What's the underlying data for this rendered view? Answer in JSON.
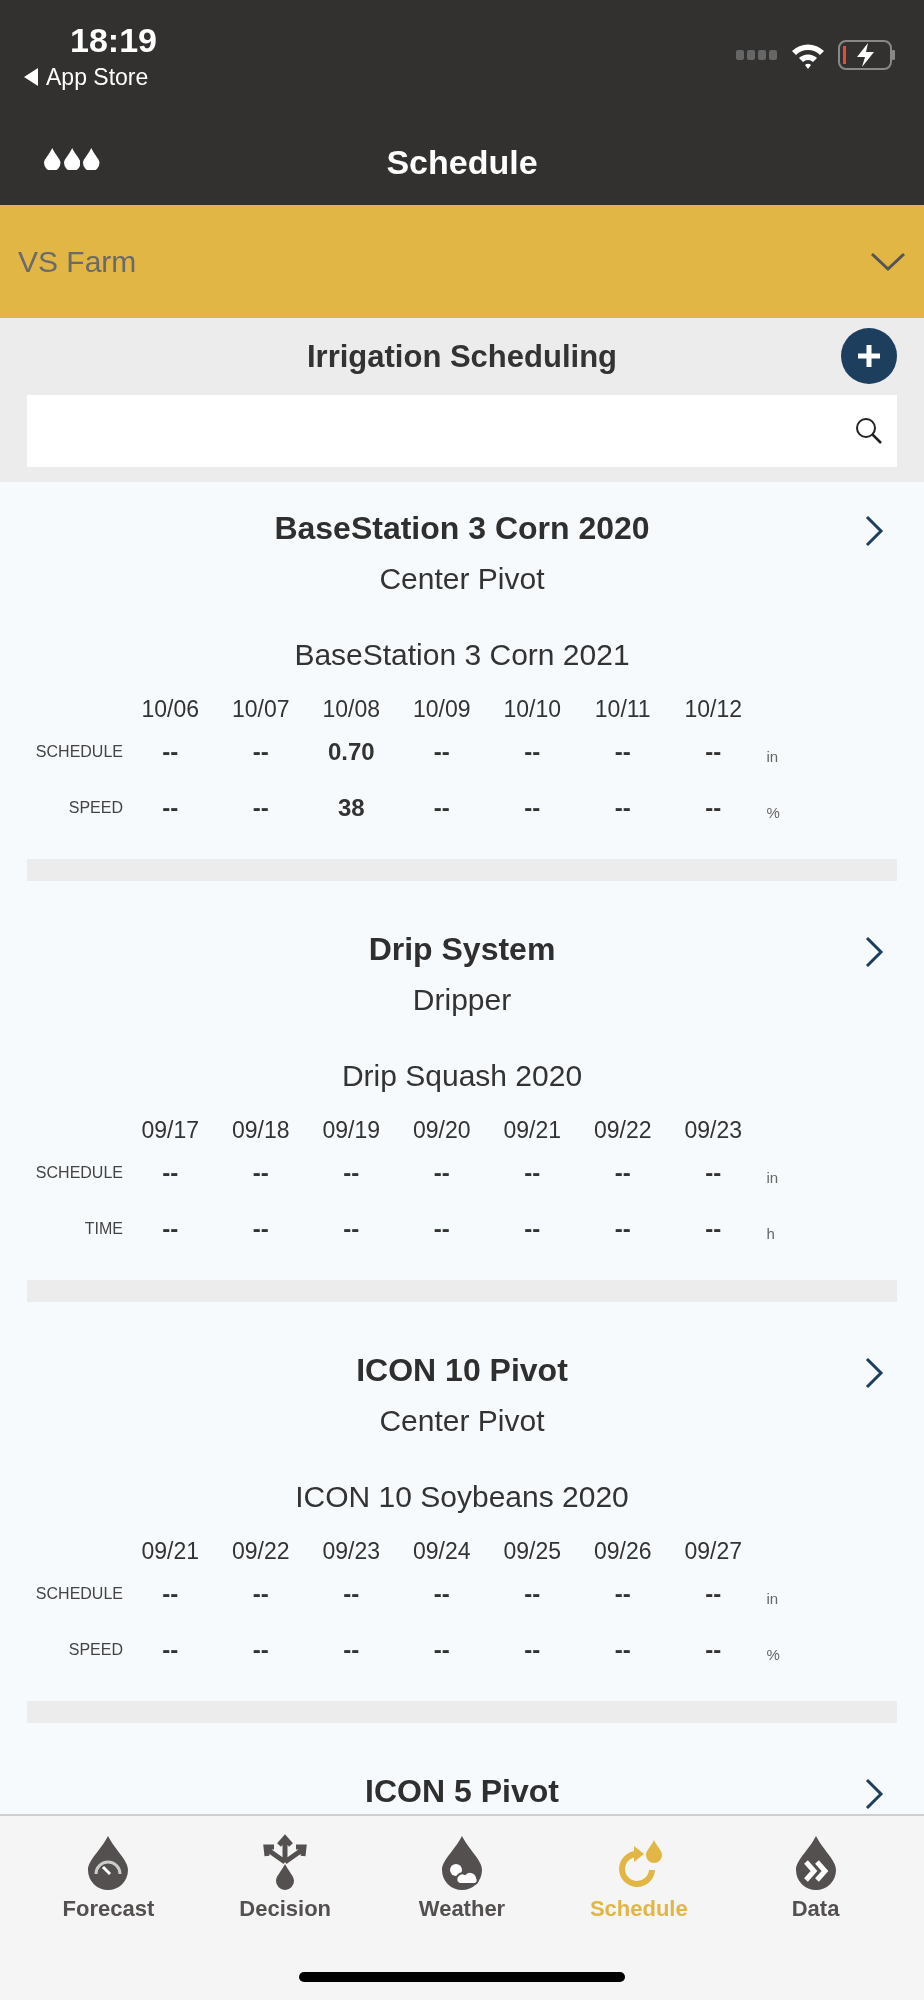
{
  "status_bar": {
    "time": "18:19",
    "back_label": "App Store"
  },
  "header": {
    "title": "Schedule"
  },
  "farm_selector": {
    "value": "VS Farm"
  },
  "section": {
    "title": "Irrigation Scheduling"
  },
  "systems": [
    {
      "name": "BaseStation 3 Corn 2020",
      "type": "Center Pivot",
      "schedule_name": "BaseStation 3 Corn 2021",
      "dates": [
        "10/06",
        "10/07",
        "10/08",
        "10/09",
        "10/10",
        "10/11",
        "10/12"
      ],
      "rows": [
        {
          "label": "SCHEDULE",
          "values": [
            "--",
            "--",
            "0.70",
            "--",
            "--",
            "--",
            "--"
          ],
          "unit": "in"
        },
        {
          "label": "SPEED",
          "values": [
            "--",
            "--",
            "38",
            "--",
            "--",
            "--",
            "--"
          ],
          "unit": "%"
        }
      ]
    },
    {
      "name": "Drip System",
      "type": "Dripper",
      "schedule_name": "Drip Squash 2020",
      "dates": [
        "09/17",
        "09/18",
        "09/19",
        "09/20",
        "09/21",
        "09/22",
        "09/23"
      ],
      "rows": [
        {
          "label": "SCHEDULE",
          "values": [
            "--",
            "--",
            "--",
            "--",
            "--",
            "--",
            "--"
          ],
          "unit": "in"
        },
        {
          "label": "TIME",
          "values": [
            "--",
            "--",
            "--",
            "--",
            "--",
            "--",
            "--"
          ],
          "unit": "h"
        }
      ]
    },
    {
      "name": "ICON 10 Pivot",
      "type": "Center Pivot",
      "schedule_name": "ICON 10 Soybeans 2020",
      "dates": [
        "09/21",
        "09/22",
        "09/23",
        "09/24",
        "09/25",
        "09/26",
        "09/27"
      ],
      "rows": [
        {
          "label": "SCHEDULE",
          "values": [
            "--",
            "--",
            "--",
            "--",
            "--",
            "--",
            "--"
          ],
          "unit": "in"
        },
        {
          "label": "SPEED",
          "values": [
            "--",
            "--",
            "--",
            "--",
            "--",
            "--",
            "--"
          ],
          "unit": "%"
        }
      ]
    },
    {
      "name": "ICON 5 Pivot"
    }
  ],
  "tabs": [
    {
      "kind": "forecast",
      "label": "Forecast",
      "selected": false
    },
    {
      "kind": "decision",
      "label": "Decision",
      "selected": false
    },
    {
      "kind": "weather",
      "label": "Weather",
      "selected": false
    },
    {
      "kind": "schedule",
      "label": "Schedule",
      "selected": true
    },
    {
      "kind": "data",
      "label": "Data",
      "selected": false
    }
  ]
}
